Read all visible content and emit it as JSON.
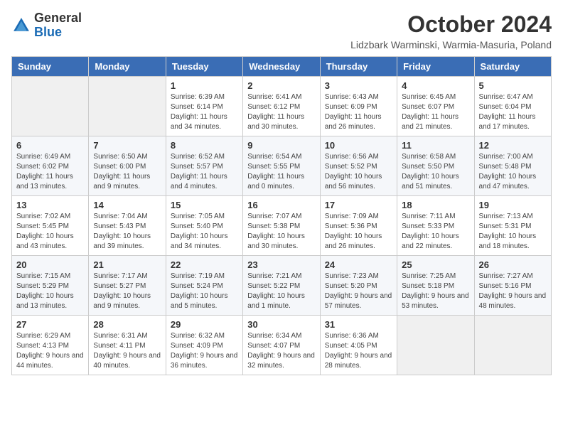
{
  "header": {
    "logo_general": "General",
    "logo_blue": "Blue",
    "month_year": "October 2024",
    "location": "Lidzbark Warminski, Warmia-Masuria, Poland"
  },
  "days_of_week": [
    "Sunday",
    "Monday",
    "Tuesday",
    "Wednesday",
    "Thursday",
    "Friday",
    "Saturday"
  ],
  "weeks": [
    [
      {
        "day": "",
        "info": ""
      },
      {
        "day": "",
        "info": ""
      },
      {
        "day": "1",
        "info": "Sunrise: 6:39 AM\nSunset: 6:14 PM\nDaylight: 11 hours and 34 minutes."
      },
      {
        "day": "2",
        "info": "Sunrise: 6:41 AM\nSunset: 6:12 PM\nDaylight: 11 hours and 30 minutes."
      },
      {
        "day": "3",
        "info": "Sunrise: 6:43 AM\nSunset: 6:09 PM\nDaylight: 11 hours and 26 minutes."
      },
      {
        "day": "4",
        "info": "Sunrise: 6:45 AM\nSunset: 6:07 PM\nDaylight: 11 hours and 21 minutes."
      },
      {
        "day": "5",
        "info": "Sunrise: 6:47 AM\nSunset: 6:04 PM\nDaylight: 11 hours and 17 minutes."
      }
    ],
    [
      {
        "day": "6",
        "info": "Sunrise: 6:49 AM\nSunset: 6:02 PM\nDaylight: 11 hours and 13 minutes."
      },
      {
        "day": "7",
        "info": "Sunrise: 6:50 AM\nSunset: 6:00 PM\nDaylight: 11 hours and 9 minutes."
      },
      {
        "day": "8",
        "info": "Sunrise: 6:52 AM\nSunset: 5:57 PM\nDaylight: 11 hours and 4 minutes."
      },
      {
        "day": "9",
        "info": "Sunrise: 6:54 AM\nSunset: 5:55 PM\nDaylight: 11 hours and 0 minutes."
      },
      {
        "day": "10",
        "info": "Sunrise: 6:56 AM\nSunset: 5:52 PM\nDaylight: 10 hours and 56 minutes."
      },
      {
        "day": "11",
        "info": "Sunrise: 6:58 AM\nSunset: 5:50 PM\nDaylight: 10 hours and 51 minutes."
      },
      {
        "day": "12",
        "info": "Sunrise: 7:00 AM\nSunset: 5:48 PM\nDaylight: 10 hours and 47 minutes."
      }
    ],
    [
      {
        "day": "13",
        "info": "Sunrise: 7:02 AM\nSunset: 5:45 PM\nDaylight: 10 hours and 43 minutes."
      },
      {
        "day": "14",
        "info": "Sunrise: 7:04 AM\nSunset: 5:43 PM\nDaylight: 10 hours and 39 minutes."
      },
      {
        "day": "15",
        "info": "Sunrise: 7:05 AM\nSunset: 5:40 PM\nDaylight: 10 hours and 34 minutes."
      },
      {
        "day": "16",
        "info": "Sunrise: 7:07 AM\nSunset: 5:38 PM\nDaylight: 10 hours and 30 minutes."
      },
      {
        "day": "17",
        "info": "Sunrise: 7:09 AM\nSunset: 5:36 PM\nDaylight: 10 hours and 26 minutes."
      },
      {
        "day": "18",
        "info": "Sunrise: 7:11 AM\nSunset: 5:33 PM\nDaylight: 10 hours and 22 minutes."
      },
      {
        "day": "19",
        "info": "Sunrise: 7:13 AM\nSunset: 5:31 PM\nDaylight: 10 hours and 18 minutes."
      }
    ],
    [
      {
        "day": "20",
        "info": "Sunrise: 7:15 AM\nSunset: 5:29 PM\nDaylight: 10 hours and 13 minutes."
      },
      {
        "day": "21",
        "info": "Sunrise: 7:17 AM\nSunset: 5:27 PM\nDaylight: 10 hours and 9 minutes."
      },
      {
        "day": "22",
        "info": "Sunrise: 7:19 AM\nSunset: 5:24 PM\nDaylight: 10 hours and 5 minutes."
      },
      {
        "day": "23",
        "info": "Sunrise: 7:21 AM\nSunset: 5:22 PM\nDaylight: 10 hours and 1 minute."
      },
      {
        "day": "24",
        "info": "Sunrise: 7:23 AM\nSunset: 5:20 PM\nDaylight: 9 hours and 57 minutes."
      },
      {
        "day": "25",
        "info": "Sunrise: 7:25 AM\nSunset: 5:18 PM\nDaylight: 9 hours and 53 minutes."
      },
      {
        "day": "26",
        "info": "Sunrise: 7:27 AM\nSunset: 5:16 PM\nDaylight: 9 hours and 48 minutes."
      }
    ],
    [
      {
        "day": "27",
        "info": "Sunrise: 6:29 AM\nSunset: 4:13 PM\nDaylight: 9 hours and 44 minutes."
      },
      {
        "day": "28",
        "info": "Sunrise: 6:31 AM\nSunset: 4:11 PM\nDaylight: 9 hours and 40 minutes."
      },
      {
        "day": "29",
        "info": "Sunrise: 6:32 AM\nSunset: 4:09 PM\nDaylight: 9 hours and 36 minutes."
      },
      {
        "day": "30",
        "info": "Sunrise: 6:34 AM\nSunset: 4:07 PM\nDaylight: 9 hours and 32 minutes."
      },
      {
        "day": "31",
        "info": "Sunrise: 6:36 AM\nSunset: 4:05 PM\nDaylight: 9 hours and 28 minutes."
      },
      {
        "day": "",
        "info": ""
      },
      {
        "day": "",
        "info": ""
      }
    ]
  ]
}
